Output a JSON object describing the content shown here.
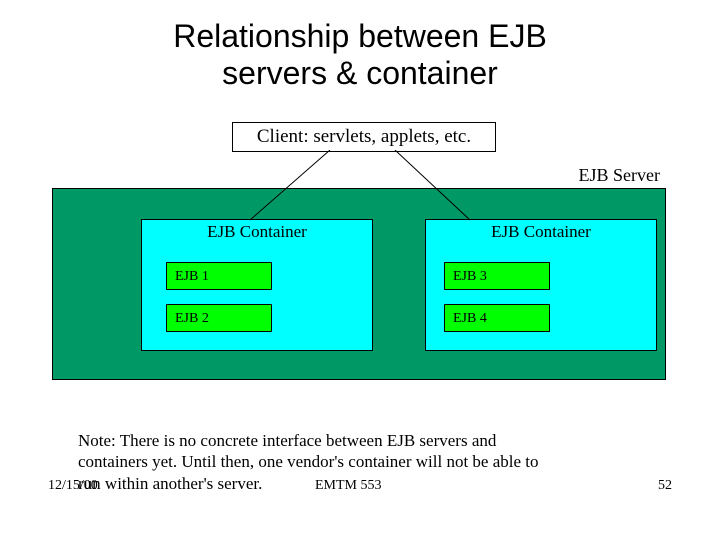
{
  "title_line1": "Relationship between EJB",
  "title_line2": "servers & container",
  "client_label": "Client: servlets, applets, etc.",
  "server_label": "EJB Server",
  "container_label_left": "EJB Container",
  "container_label_right": "EJB Container",
  "ejbs": {
    "e1": "EJB 1",
    "e2": "EJB 2",
    "e3": "EJB 3",
    "e4": "EJB 4"
  },
  "note": "Note: There is no concrete interface between EJB servers and containers yet.  Until then, one vendor's container will not be able to run within another's server.",
  "footer": {
    "date": "12/15/00",
    "course": "EMTM 553",
    "page": "52"
  }
}
